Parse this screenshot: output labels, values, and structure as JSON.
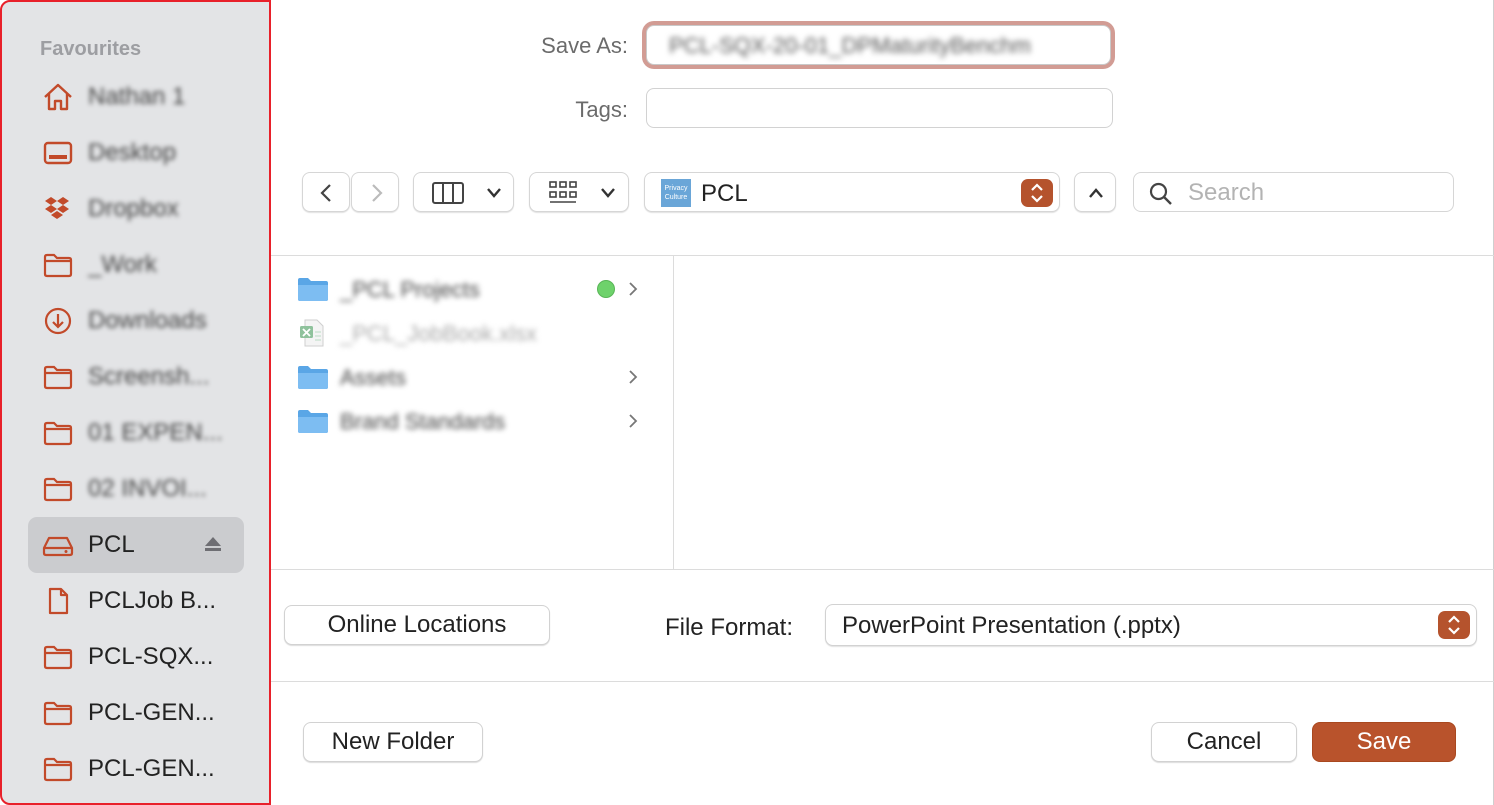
{
  "sidebar": {
    "heading": "Favourites",
    "items": [
      {
        "label": "Nathan 1",
        "icon": "home-icon",
        "blurred": true
      },
      {
        "label": "Desktop",
        "icon": "desktop-icon",
        "blurred": true
      },
      {
        "label": "Dropbox",
        "icon": "dropbox-icon",
        "blurred": true
      },
      {
        "label": "_Work",
        "icon": "folder-icon",
        "blurred": true
      },
      {
        "label": "Downloads",
        "icon": "downloads-icon",
        "blurred": true
      },
      {
        "label": "Screensh...",
        "icon": "folder-icon",
        "blurred": true
      },
      {
        "label": "01 EXPEN...",
        "icon": "folder-icon",
        "blurred": true
      },
      {
        "label": "02 INVOI...",
        "icon": "folder-icon",
        "blurred": true
      },
      {
        "label": "PCL",
        "icon": "drive-icon",
        "selected": true
      },
      {
        "label": "PCLJob B...",
        "icon": "document-icon"
      },
      {
        "label": "PCL-SQX...",
        "icon": "folder-icon"
      },
      {
        "label": "PCL-GEN...",
        "icon": "folder-icon"
      },
      {
        "label": "PCL-GEN...",
        "icon": "folder-icon"
      }
    ]
  },
  "form": {
    "save_as_label": "Save As:",
    "save_as_value": "PCL-SQX-20-01_DPMaturityBenchm",
    "tags_label": "Tags:"
  },
  "toolbar": {
    "location": "PCL",
    "location_icon_text": "Privacy Culture",
    "search_placeholder": "Search"
  },
  "files": [
    {
      "name": "_PCL Projects",
      "type": "folder",
      "tag": "green",
      "expandable": true
    },
    {
      "name": "_PCL_JobBook.xlsx",
      "type": "excel",
      "dimmed": true
    },
    {
      "name": "Assets",
      "type": "folder",
      "expandable": true
    },
    {
      "name": "Brand Standards",
      "type": "folder",
      "expandable": true
    }
  ],
  "footer": {
    "online_locations": "Online Locations",
    "file_format_label": "File Format:",
    "file_format_value": "PowerPoint Presentation (.pptx)",
    "new_folder": "New Folder",
    "cancel": "Cancel",
    "save": "Save"
  },
  "colors": {
    "accent": "#b9532c",
    "sidebar_bg": "#e3e4e6",
    "highlight_border": "#e8202a",
    "focus_ring": "#d29c94",
    "tag_green": "#6ed26b"
  }
}
